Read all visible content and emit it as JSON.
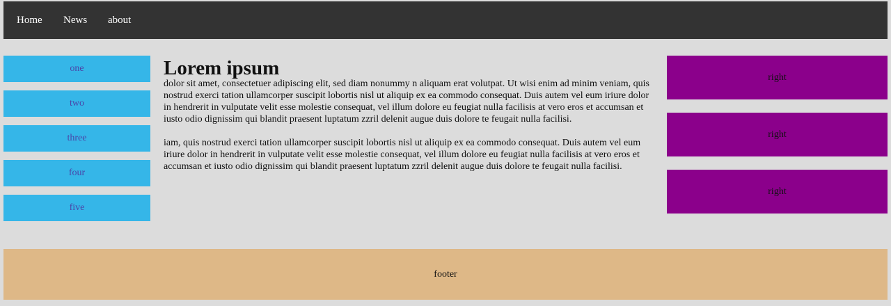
{
  "topnav": {
    "items": [
      {
        "label": "Home"
      },
      {
        "label": "News"
      },
      {
        "label": "about"
      }
    ]
  },
  "sidenav": {
    "items": [
      {
        "label": "one"
      },
      {
        "label": "two"
      },
      {
        "label": "three"
      },
      {
        "label": "four"
      },
      {
        "label": "five"
      }
    ]
  },
  "main": {
    "title": "Lorem ipsum",
    "paragraphs": [
      "dolor sit amet, consectetuer adipiscing elit, sed diam nonummy n aliquam erat volutpat. Ut wisi enim ad minim veniam, quis nostrud exerci tation ullamcorper suscipit lobortis nisl ut aliquip ex ea commodo consequat. Duis autem vel eum iriure dolor in hendrerit in vulputate velit esse molestie consequat, vel illum dolore eu feugiat nulla facilisis at vero eros et accumsan et iusto odio dignissim qui blandit praesent luptatum zzril delenit augue duis dolore te feugait nulla facilisi.",
      "iam, quis nostrud exerci tation ullamcorper suscipit lobortis nisl ut aliquip ex ea commodo consequat. Duis autem vel eum iriure dolor in hendrerit in vulputate velit esse molestie consequat, vel illum dolore eu feugiat nulla facilisis at vero eros et accumsan et iusto odio dignissim qui blandit praesent luptatum zzril delenit augue duis dolore te feugait nulla facilisi."
    ]
  },
  "right": {
    "boxes": [
      {
        "label": "right"
      },
      {
        "label": "right"
      },
      {
        "label": "right"
      }
    ]
  },
  "footer": {
    "label": "footer"
  },
  "colors": {
    "nav_bg": "#333333",
    "side_bg": "#35b6e8",
    "right_bg": "#8b008b",
    "footer_bg": "#deb887",
    "page_bg": "#dcdcdc"
  }
}
